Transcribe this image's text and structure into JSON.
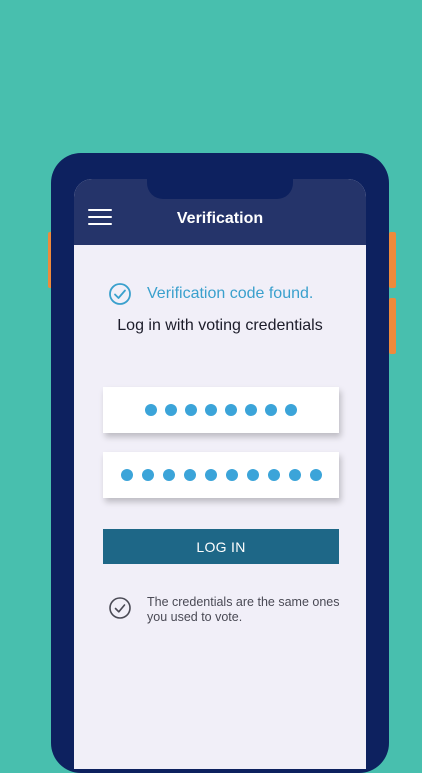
{
  "header": {
    "title": "Verification",
    "menu_icon": "hamburger-menu-icon"
  },
  "status": {
    "text": "Verification code found.",
    "icon": "check-circle-icon",
    "color": "#3aa0cd"
  },
  "instruction": {
    "text": "Log in with voting credentials"
  },
  "fields": {
    "username_masked_length": 8,
    "password_masked_length": 10
  },
  "login_button": {
    "label": "LOG IN",
    "color": "#1e6787"
  },
  "note": {
    "text": "The credentials are the same ones you used to vote.",
    "icon": "check-circle-icon"
  },
  "colors": {
    "background": "#48bfae",
    "phone_frame": "#0d215f",
    "header": "#25346a",
    "accent_orange": "#ee8a3b",
    "dot": "#3ba4d9"
  }
}
